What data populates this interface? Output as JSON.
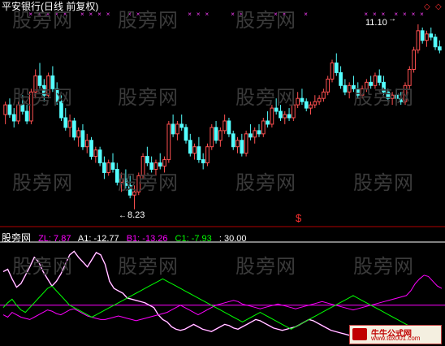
{
  "header": {
    "title": "平安银行(日线 前复权)"
  },
  "price_labels": {
    "high": "11.10",
    "low": "8.23"
  },
  "indicator": {
    "name": "股旁网",
    "zl": "ZL: 7.87",
    "a1": "A1: -12.77",
    "b1": "B1: -13.26",
    "c1": "C1: -7.93",
    "level": ": 30.00"
  },
  "watermark": "股旁网",
  "logo": {
    "line1": "牛牛公式网",
    "line2": "www.tdx001.com"
  },
  "colors": {
    "up": "#ff5050",
    "down": "#54ffff",
    "zl": "#ff00ff",
    "a1": "#ffffff",
    "b1": "#ff00ff",
    "c1": "#00ff00",
    "signal": "#ff40ff",
    "level": "#ff00ff"
  },
  "chart_data": [
    {
      "type": "candlestick",
      "title": "平安银行(日线 前复权)",
      "annotations": [
        {
          "text": "11.10",
          "kind": "high"
        },
        {
          "text": "8.23",
          "kind": "low"
        }
      ],
      "ohlc": [
        [
          9.7,
          9.9,
          9.55,
          9.85
        ],
        [
          9.85,
          9.95,
          9.65,
          9.7
        ],
        [
          9.7,
          9.8,
          9.5,
          9.6
        ],
        [
          9.6,
          9.9,
          9.55,
          9.85
        ],
        [
          9.85,
          10.0,
          9.7,
          9.75
        ],
        [
          9.75,
          9.85,
          9.55,
          9.6
        ],
        [
          9.6,
          10.1,
          9.55,
          10.05
        ],
        [
          10.05,
          10.4,
          9.95,
          10.3
        ],
        [
          10.3,
          10.5,
          10.1,
          10.15
        ],
        [
          10.15,
          10.25,
          9.9,
          10.0
        ],
        [
          10.0,
          10.35,
          9.95,
          10.3
        ],
        [
          10.3,
          10.45,
          10.05,
          10.1
        ],
        [
          10.1,
          10.2,
          9.85,
          9.9
        ],
        [
          9.9,
          10.0,
          9.6,
          9.65
        ],
        [
          9.65,
          9.8,
          9.45,
          9.5
        ],
        [
          9.5,
          9.7,
          9.35,
          9.6
        ],
        [
          9.6,
          9.65,
          9.3,
          9.35
        ],
        [
          9.35,
          9.5,
          9.2,
          9.45
        ],
        [
          9.45,
          9.55,
          9.15,
          9.2
        ],
        [
          9.2,
          9.4,
          9.1,
          9.3
        ],
        [
          9.3,
          9.35,
          9.0,
          9.05
        ],
        [
          9.05,
          9.2,
          8.95,
          9.15
        ],
        [
          9.15,
          9.2,
          8.9,
          8.95
        ],
        [
          8.95,
          9.05,
          8.7,
          8.8
        ],
        [
          8.8,
          9.0,
          8.75,
          8.95
        ],
        [
          8.95,
          9.1,
          8.8,
          8.85
        ],
        [
          8.85,
          8.95,
          8.6,
          8.65
        ],
        [
          8.65,
          8.8,
          8.5,
          8.7
        ],
        [
          8.7,
          8.85,
          8.55,
          8.6
        ],
        [
          8.6,
          8.75,
          8.4,
          8.45
        ],
        [
          8.45,
          8.6,
          8.23,
          8.5
        ],
        [
          8.5,
          8.8,
          8.45,
          8.75
        ],
        [
          8.75,
          9.1,
          8.7,
          9.05
        ],
        [
          9.05,
          9.2,
          8.9,
          8.95
        ],
        [
          8.95,
          9.05,
          8.8,
          8.85
        ],
        [
          8.85,
          9.0,
          8.75,
          8.95
        ],
        [
          8.95,
          9.1,
          8.85,
          8.9
        ],
        [
          8.9,
          9.05,
          8.8,
          9.0
        ],
        [
          9.0,
          9.6,
          8.95,
          9.55
        ],
        [
          9.55,
          9.7,
          9.35,
          9.4
        ],
        [
          9.4,
          9.6,
          9.3,
          9.55
        ],
        [
          9.55,
          9.7,
          9.45,
          9.5
        ],
        [
          9.5,
          9.55,
          9.25,
          9.3
        ],
        [
          9.3,
          9.4,
          9.05,
          9.1
        ],
        [
          9.1,
          9.25,
          9.0,
          9.2
        ],
        [
          9.2,
          9.35,
          8.95,
          9.0
        ],
        [
          9.0,
          9.1,
          8.85,
          8.95
        ],
        [
          8.95,
          9.25,
          8.9,
          9.2
        ],
        [
          9.2,
          9.55,
          9.15,
          9.5
        ],
        [
          9.5,
          9.6,
          9.25,
          9.3
        ],
        [
          9.3,
          9.5,
          9.2,
          9.45
        ],
        [
          9.45,
          9.7,
          9.4,
          9.6
        ],
        [
          9.6,
          9.65,
          9.35,
          9.4
        ],
        [
          9.4,
          9.45,
          9.15,
          9.2
        ],
        [
          9.2,
          9.35,
          9.1,
          9.3
        ],
        [
          9.3,
          9.4,
          9.05,
          9.1
        ],
        [
          9.1,
          9.45,
          9.05,
          9.4
        ],
        [
          9.4,
          9.55,
          9.3,
          9.35
        ],
        [
          9.35,
          9.5,
          9.25,
          9.45
        ],
        [
          9.45,
          9.55,
          9.35,
          9.4
        ],
        [
          9.4,
          9.65,
          9.35,
          9.6
        ],
        [
          9.6,
          9.75,
          9.5,
          9.55
        ],
        [
          9.55,
          9.85,
          9.5,
          9.8
        ],
        [
          9.8,
          9.95,
          9.7,
          9.75
        ],
        [
          9.75,
          9.85,
          9.6,
          9.65
        ],
        [
          9.65,
          9.75,
          9.55,
          9.7
        ],
        [
          9.7,
          9.8,
          9.6,
          9.65
        ],
        [
          9.65,
          9.9,
          9.6,
          9.85
        ],
        [
          9.85,
          10.05,
          9.8,
          9.95
        ],
        [
          9.95,
          10.1,
          9.85,
          9.9
        ],
        [
          9.9,
          9.95,
          9.75,
          9.8
        ],
        [
          9.8,
          9.9,
          9.7,
          9.85
        ],
        [
          9.85,
          10.0,
          9.8,
          9.9
        ],
        [
          9.9,
          10.0,
          9.85,
          9.95
        ],
        [
          9.95,
          10.1,
          9.9,
          10.05
        ],
        [
          10.05,
          10.3,
          10.0,
          10.25
        ],
        [
          10.25,
          10.55,
          10.2,
          10.5
        ],
        [
          10.5,
          10.65,
          10.3,
          10.35
        ],
        [
          10.35,
          10.45,
          10.1,
          10.15
        ],
        [
          10.15,
          10.25,
          10.0,
          10.05
        ],
        [
          10.05,
          10.2,
          9.95,
          10.15
        ],
        [
          10.15,
          10.3,
          10.05,
          10.1
        ],
        [
          10.1,
          10.2,
          9.95,
          10.0
        ],
        [
          10.0,
          10.15,
          9.95,
          10.1
        ],
        [
          10.1,
          10.25,
          10.05,
          10.2
        ],
        [
          10.2,
          10.3,
          10.1,
          10.15
        ],
        [
          10.15,
          10.35,
          10.1,
          10.3
        ],
        [
          10.3,
          10.4,
          10.15,
          10.2
        ],
        [
          10.2,
          10.3,
          10.0,
          10.05
        ],
        [
          10.05,
          10.1,
          9.9,
          9.95
        ],
        [
          9.95,
          10.05,
          9.85,
          10.0
        ],
        [
          10.0,
          10.1,
          9.9,
          9.95
        ],
        [
          9.95,
          10.05,
          9.85,
          9.9
        ],
        [
          9.9,
          10.2,
          9.85,
          10.15
        ],
        [
          10.15,
          10.45,
          10.1,
          10.4
        ],
        [
          10.4,
          10.75,
          10.35,
          10.7
        ],
        [
          10.7,
          11.1,
          10.65,
          11.0
        ],
        [
          11.0,
          11.05,
          10.8,
          10.85
        ],
        [
          10.85,
          11.0,
          10.75,
          10.95
        ],
        [
          10.95,
          11.05,
          10.85,
          10.9
        ],
        [
          10.9,
          10.95,
          10.7,
          10.75
        ],
        [
          10.75,
          10.85,
          10.65,
          10.7
        ]
      ]
    },
    {
      "type": "line",
      "title": "股旁网",
      "series": [
        {
          "name": "ZL",
          "values": [
            58,
            60,
            52,
            45,
            48,
            55,
            62,
            70,
            66,
            58,
            52,
            46,
            50,
            56,
            64,
            72,
            75,
            70,
            66,
            62,
            68,
            74,
            72,
            64,
            50,
            44,
            42,
            40,
            36,
            35,
            34,
            33,
            32,
            30,
            28,
            22,
            18,
            16,
            12,
            10,
            9,
            10,
            12,
            14,
            12,
            10,
            9,
            8,
            10,
            12,
            14,
            13,
            11,
            10,
            12,
            14,
            16,
            18,
            17,
            15,
            13,
            11,
            10,
            9,
            10,
            11,
            12,
            14,
            16,
            18,
            17,
            15,
            13,
            11,
            9,
            8,
            7,
            6,
            5,
            4,
            6,
            8,
            10,
            9,
            8,
            7,
            6,
            5,
            4,
            3,
            2,
            1,
            2,
            3,
            4,
            5,
            6,
            7,
            8,
            7
          ]
        },
        {
          "name": "A1",
          "values": [
            58,
            60,
            52,
            45,
            48,
            55,
            62,
            70,
            66,
            58,
            52,
            46,
            50,
            56,
            64,
            72,
            75,
            70,
            66,
            62,
            68,
            74,
            72,
            64,
            50,
            44,
            42,
            40,
            36,
            35,
            34,
            33,
            32,
            30,
            28,
            22,
            18,
            16,
            12,
            10,
            9,
            10,
            12,
            14,
            12,
            10,
            9,
            8,
            10,
            12,
            14,
            13,
            11,
            10,
            12,
            14,
            16,
            18,
            17,
            15,
            13,
            11,
            10,
            9,
            10,
            11,
            12,
            14,
            16,
            18,
            17,
            15,
            13,
            11,
            9,
            8,
            7,
            6,
            5,
            4,
            6,
            8,
            10,
            9,
            8,
            7,
            6,
            5,
            4,
            3,
            2,
            1,
            2,
            3,
            4,
            5,
            6,
            7,
            8,
            7
          ]
        },
        {
          "name": "B1",
          "values": [
            22,
            20,
            24,
            22,
            20,
            19,
            18,
            20,
            22,
            24,
            26,
            25,
            23,
            22,
            24,
            26,
            27,
            25,
            23,
            21,
            20,
            19,
            18,
            18,
            19,
            20,
            21,
            20,
            19,
            18,
            17,
            18,
            19,
            20,
            21,
            22,
            23,
            24,
            26,
            28,
            30,
            28,
            26,
            24,
            22,
            24,
            26,
            28,
            30,
            31,
            32,
            33,
            34,
            33,
            31,
            30,
            29,
            28,
            27,
            28,
            29,
            30,
            31,
            30,
            29,
            28,
            27,
            28,
            29,
            30,
            31,
            32,
            33,
            32,
            31,
            30,
            29,
            28,
            27,
            26,
            27,
            28,
            29,
            30,
            31,
            32,
            33,
            34,
            35,
            36,
            37,
            38,
            42,
            48,
            52,
            55,
            54,
            50,
            46,
            44
          ]
        },
        {
          "name": "C1",
          "values": [
            28,
            32,
            35,
            30,
            26,
            24,
            28,
            32,
            36,
            40,
            44,
            46,
            42,
            38,
            34,
            30,
            28,
            26,
            24,
            22,
            20,
            22,
            24,
            26,
            28,
            30,
            32,
            34,
            36,
            38,
            40,
            42,
            44,
            46,
            48,
            50,
            52,
            50,
            48,
            46,
            44,
            42,
            40,
            38,
            36,
            34,
            32,
            30,
            28,
            26,
            24,
            22,
            20,
            18,
            16,
            18,
            20,
            22,
            24,
            22,
            20,
            18,
            16,
            14,
            12,
            10,
            12,
            14,
            16,
            18,
            20,
            22,
            24,
            26,
            28,
            30,
            32,
            34,
            36,
            38,
            36,
            34,
            32,
            30,
            28,
            26,
            24,
            22,
            20,
            18,
            16,
            14,
            12,
            10,
            8,
            6,
            4,
            2,
            1,
            3
          ]
        }
      ],
      "level": 30.0
    }
  ]
}
